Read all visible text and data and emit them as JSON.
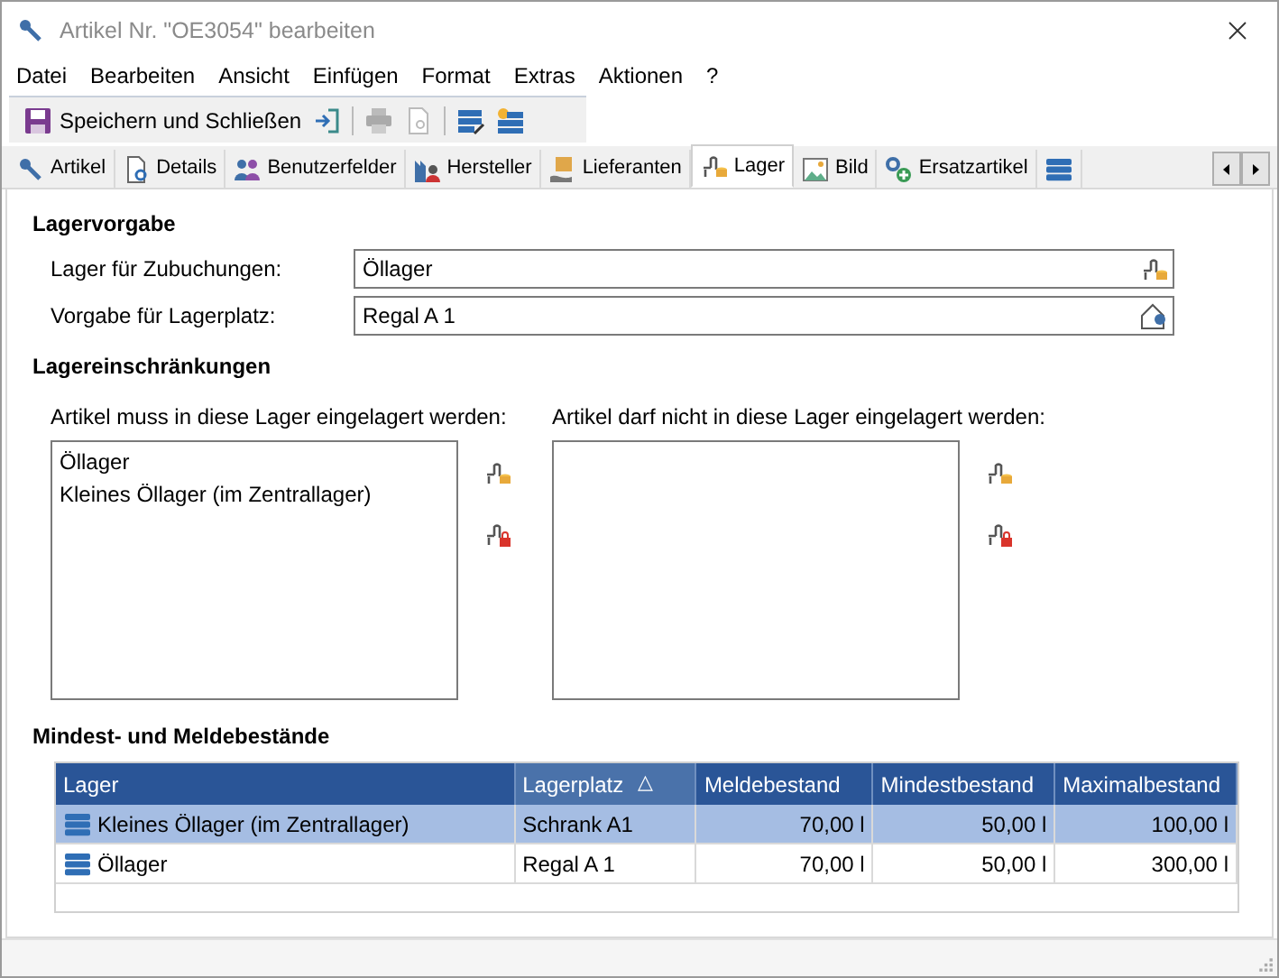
{
  "window": {
    "title": "Artikel Nr. \"OE3054\" bearbeiten"
  },
  "menu": [
    "Datei",
    "Bearbeiten",
    "Ansicht",
    "Einfügen",
    "Format",
    "Extras",
    "Aktionen",
    "?"
  ],
  "toolbar": {
    "save_label": "Speichern und Schließen"
  },
  "tabs": [
    {
      "kind": "article",
      "label": "Artikel",
      "selected": false
    },
    {
      "kind": "details",
      "label": "Details",
      "selected": false
    },
    {
      "kind": "userfields",
      "label": "Benutzerfelder",
      "selected": false
    },
    {
      "kind": "manufacturer",
      "label": "Hersteller",
      "selected": false
    },
    {
      "kind": "suppliers",
      "label": "Lieferanten",
      "selected": false
    },
    {
      "kind": "stock",
      "label": "Lager",
      "selected": true
    },
    {
      "kind": "picture",
      "label": "Bild",
      "selected": false
    },
    {
      "kind": "replacement",
      "label": "Ersatzartikel",
      "selected": false
    },
    {
      "kind": "storage",
      "selected": false
    }
  ],
  "lagervorgabe": {
    "heading": "Lagervorgabe",
    "fields": [
      {
        "kind": "stock",
        "label": "Lager für Zubuchungen:",
        "value": "Öllager"
      },
      {
        "kind": "location",
        "label": "Vorgabe für  Lagerplatz:",
        "value": "Regal A 1"
      }
    ]
  },
  "restrictions": {
    "heading": "Lagereinschränkungen",
    "lists": [
      {
        "label": "Artikel muss in diese Lager eingelagert werden:",
        "items": [
          "Öllager",
          "Kleines Öllager (im Zentrallager)"
        ]
      },
      {
        "label": "Artikel darf nicht in diese Lager eingelagert werden:"
      }
    ]
  },
  "stock_levels": {
    "heading": "Mindest- und Meldebestände",
    "columns": [
      {
        "label": "Lager",
        "sorted": false
      },
      {
        "label": "Lagerplatz",
        "sorted": true
      },
      {
        "label": "Meldebestand",
        "sorted": false
      },
      {
        "label": "Mindestbestand",
        "sorted": false
      },
      {
        "label": "Maximalbestand",
        "sorted": false
      }
    ],
    "sort_mark": "△",
    "rows": [
      {
        "selected": true,
        "cells": [
          "Kleines Öllager (im Zentrallager)",
          "Schrank A1",
          "70,00 l",
          "50,00 l",
          "100,00 l"
        ]
      },
      {
        "selected": false,
        "cells": [
          "Öllager",
          "Regal A 1",
          "70,00 l",
          "50,00 l",
          "300,00 l"
        ]
      }
    ]
  }
}
